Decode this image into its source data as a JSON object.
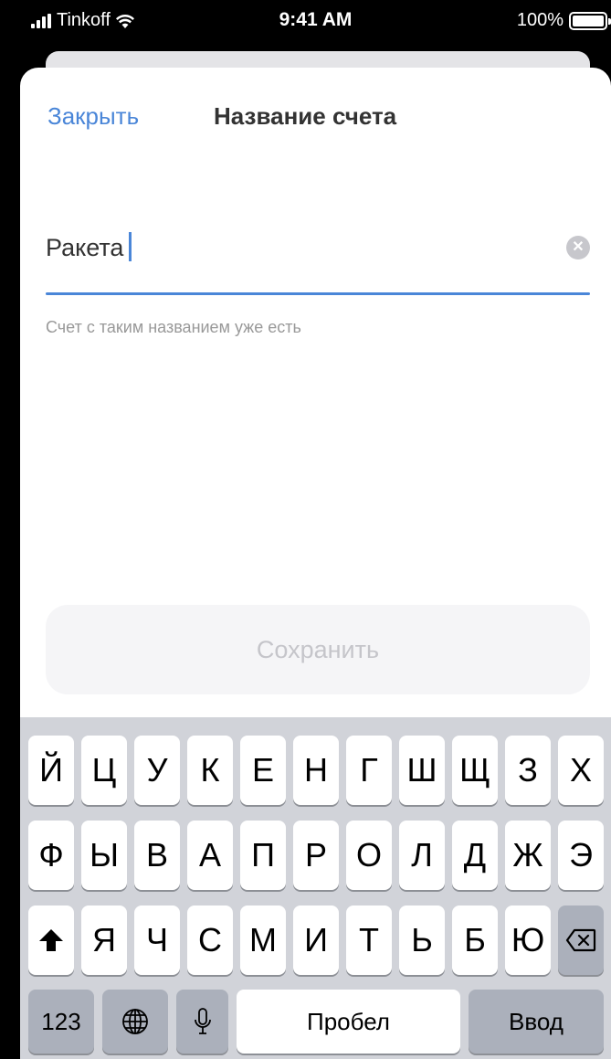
{
  "status_bar": {
    "carrier": "Tinkoff",
    "time": "9:41 AM",
    "battery": "100%"
  },
  "sheet": {
    "close_label": "Закрыть",
    "title": "Название счета",
    "input_value": "Ракета",
    "hint": "Счет с таким названием уже есть",
    "save_label": "Сохранить"
  },
  "keyboard": {
    "row1": [
      "Й",
      "Ц",
      "У",
      "К",
      "Е",
      "Н",
      "Г",
      "Ш",
      "Щ",
      "З",
      "Х"
    ],
    "row2": [
      "Ф",
      "Ы",
      "В",
      "А",
      "П",
      "Р",
      "О",
      "Л",
      "Д",
      "Ж",
      "Э"
    ],
    "row3": [
      "Я",
      "Ч",
      "С",
      "М",
      "И",
      "Т",
      "Ь",
      "Б",
      "Ю"
    ],
    "numbers_label": "123",
    "space_label": "Пробел",
    "return_label": "Ввод"
  },
  "colors": {
    "accent": "#4a86d8",
    "keyboard_bg": "#d1d3d9",
    "dark_key": "#abb0bb"
  }
}
